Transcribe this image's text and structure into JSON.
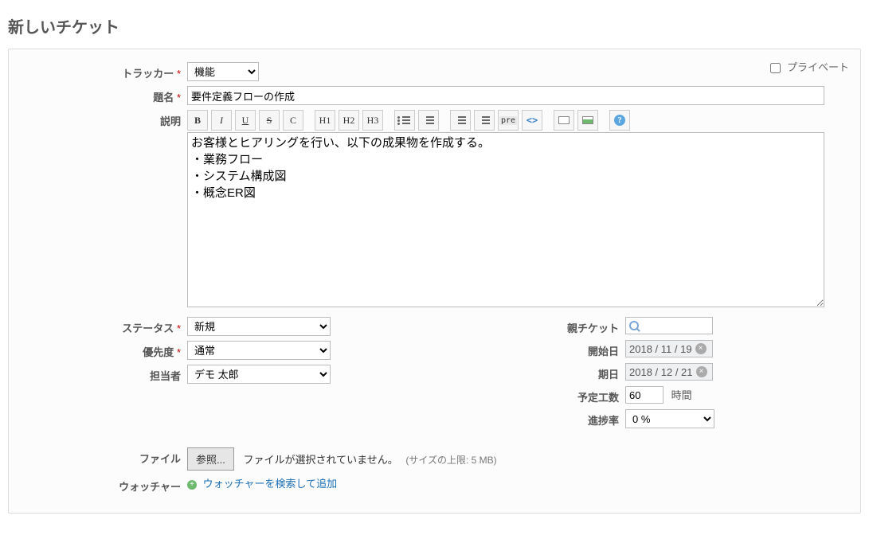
{
  "page_title": "新しいチケット",
  "private_label": "プライベート",
  "fields": {
    "tracker": {
      "label": "トラッカー",
      "value": "機能"
    },
    "subject": {
      "label": "題名",
      "value": "要件定義フローの作成"
    },
    "description": {
      "label": "説明",
      "value": "お客様とヒアリングを行い、以下の成果物を作成する。\n・業務フロー\n・システム構成図\n・概念ER図"
    },
    "status": {
      "label": "ステータス",
      "value": "新規"
    },
    "priority": {
      "label": "優先度",
      "value": "通常"
    },
    "assignee": {
      "label": "担当者",
      "value": "デモ 太郎"
    },
    "parent": {
      "label": "親チケット"
    },
    "start_date": {
      "label": "開始日",
      "value": "2018 / 11 / 19"
    },
    "due_date": {
      "label": "期日",
      "value": "2018 / 12 / 21"
    },
    "estimated": {
      "label": "予定工数",
      "value": "60",
      "unit": "時間"
    },
    "done_ratio": {
      "label": "進捗率",
      "value": "0 %"
    },
    "files": {
      "label": "ファイル",
      "button": "参照...",
      "status": "ファイルが選択されていません。",
      "hint": "(サイズの上限: 5 MB)"
    },
    "watchers": {
      "label": "ウォッチャー",
      "search_link": "ウォッチャーを検索して追加"
    }
  },
  "toolbar": {
    "bold": "B",
    "italic": "I",
    "underline": "U",
    "strike": "S",
    "code": "C",
    "h1": "H1",
    "h2": "H2",
    "h3": "H3",
    "pre": "pre"
  }
}
